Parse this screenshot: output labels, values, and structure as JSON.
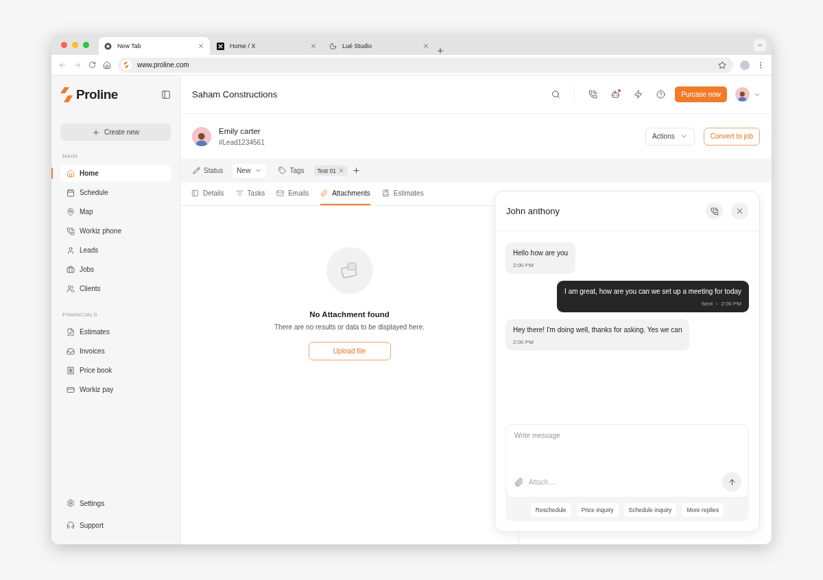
{
  "browser": {
    "tabs": [
      {
        "title": "New Tab",
        "selected": true
      },
      {
        "title": "Home / X",
        "selected": false
      },
      {
        "title": "Lué Studio",
        "selected": false
      }
    ],
    "url": "www.proline.com"
  },
  "app": {
    "brand": "Proline",
    "title": "Saham Constructions",
    "purchase_button": "Purcase now"
  },
  "sidebar": {
    "create_button": "Create new",
    "sections": [
      {
        "title": "MAIN",
        "items": [
          {
            "label": "Home",
            "selected": true
          },
          {
            "label": "Schedule",
            "selected": false
          },
          {
            "label": "Map",
            "selected": false
          },
          {
            "label": "Workiz phone",
            "selected": false
          },
          {
            "label": "Leads",
            "selected": false
          },
          {
            "label": "Jobs",
            "selected": false
          },
          {
            "label": "Clients",
            "selected": false
          }
        ]
      },
      {
        "title": "FINANCIALS",
        "items": [
          {
            "label": "Estimates",
            "selected": false
          },
          {
            "label": "Invoices",
            "selected": false
          },
          {
            "label": "Price book",
            "selected": false
          },
          {
            "label": "Workiz pay",
            "selected": false
          }
        ]
      }
    ],
    "footer": [
      "Settings",
      "Support"
    ]
  },
  "lead": {
    "name": "Emily carter",
    "id": "#Lead1234561",
    "actions_button": "Actions",
    "convert_button": "Convert to job",
    "status_label": "Status",
    "status_value": "New",
    "tags_label": "Tags",
    "tags": [
      "Test 01"
    ]
  },
  "tabs": [
    {
      "label": "Details",
      "selected": false
    },
    {
      "label": "Tasks",
      "selected": false
    },
    {
      "label": "Emails",
      "selected": false
    },
    {
      "label": "Attachments",
      "selected": true
    },
    {
      "label": "Estimates",
      "selected": false
    }
  ],
  "empty_state": {
    "title": "No Attachment found",
    "text": "There are no results or data to be displayed here.",
    "button": "Upload file"
  },
  "chat": {
    "name": "John anthony",
    "messages": [
      {
        "kind": "incoming",
        "text": "Hello how are you",
        "time": "2:00 PM"
      },
      {
        "kind": "outgoing",
        "text": "I am great, how are you can we set up a meeting for today",
        "status": "Sent",
        "time": "2:00 PM"
      },
      {
        "kind": "incoming",
        "text": "Hey there! I'm doing well, thanks for asking. Yes we can",
        "time": "2:00 PM"
      }
    ],
    "message_placeholder": "Write message",
    "attach_placeholder": "Attach....",
    "quick_replies": [
      "Reschedule",
      "Price inquiry",
      "Schedule inquiry",
      "More replies"
    ]
  }
}
